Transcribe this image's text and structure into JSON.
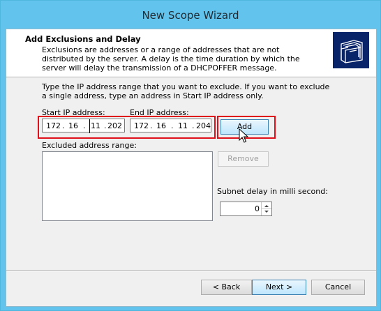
{
  "window": {
    "title": "New Scope Wizard"
  },
  "header": {
    "title": "Add Exclusions and Delay",
    "description": "Exclusions are addresses or a range of addresses that are not distributed by the server. A delay is the time duration by which the server will delay the transmission of a DHCPOFFER message.",
    "icon": "folder-icon"
  },
  "instructions": "Type the IP address range that you want to exclude. If you want to exclude a single address, type an address in Start IP address only.",
  "start_ip": {
    "label": "Start IP address:",
    "octets": [
      "172",
      "16",
      "11",
      "202"
    ]
  },
  "end_ip": {
    "label": "End IP address:",
    "octets": [
      "172",
      "16",
      "11",
      "204"
    ]
  },
  "buttons": {
    "add": "Add",
    "remove": "Remove",
    "back": "< Back",
    "next": "Next >",
    "cancel": "Cancel"
  },
  "excluded": {
    "label": "Excluded address range:",
    "items": []
  },
  "subnet_delay": {
    "label": "Subnet delay in milli second:",
    "value": "0"
  },
  "colors": {
    "title_bar": "#62c4ec",
    "highlight": "#e0101a",
    "header_icon_bg": "#0a246a"
  }
}
